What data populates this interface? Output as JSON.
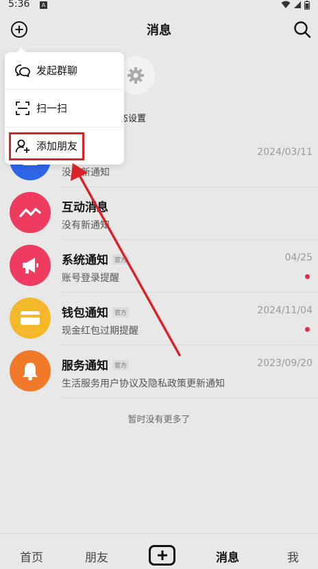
{
  "status_bar": {
    "time": "5:36",
    "notification_letter": "A"
  },
  "header": {
    "title": "消息"
  },
  "quick_action": {
    "label": "态设置"
  },
  "messages": [
    {
      "title": "",
      "subtitle": "没有新通知",
      "time": "2024/03/11",
      "color": "#2f66e8"
    },
    {
      "title": "互动消息",
      "subtitle": "没有新通知",
      "time": "",
      "color": "#ee3b5f"
    },
    {
      "title": "系统通知",
      "badge": "官方",
      "subtitle": "账号登录提醒",
      "time": "04/25",
      "unread": true,
      "color": "#ee3b5f"
    },
    {
      "title": "钱包通知",
      "badge": "官方",
      "subtitle": "现金红包过期提醒",
      "time": "2024/11/04",
      "unread": true,
      "color": "#f3b92a"
    },
    {
      "title": "服务通知",
      "badge": "官方",
      "subtitle": "生活服务用户协议及隐私政策更新通知",
      "time": "2023/09/20",
      "color": "#f07a2a"
    }
  ],
  "list_footer": "暂时没有更多了",
  "tabbar": {
    "home": "首页",
    "friends": "朋友",
    "messages": "消息",
    "me": "我"
  },
  "menu": {
    "items": [
      {
        "label": "发起群聊",
        "icon": "group-chat-icon"
      },
      {
        "label": "扫一扫",
        "icon": "scan-icon"
      },
      {
        "label": "添加朋友",
        "icon": "add-friend-icon"
      }
    ]
  },
  "colors": {
    "highlight": "#d8232a",
    "unread_dot": "#e8294a"
  }
}
